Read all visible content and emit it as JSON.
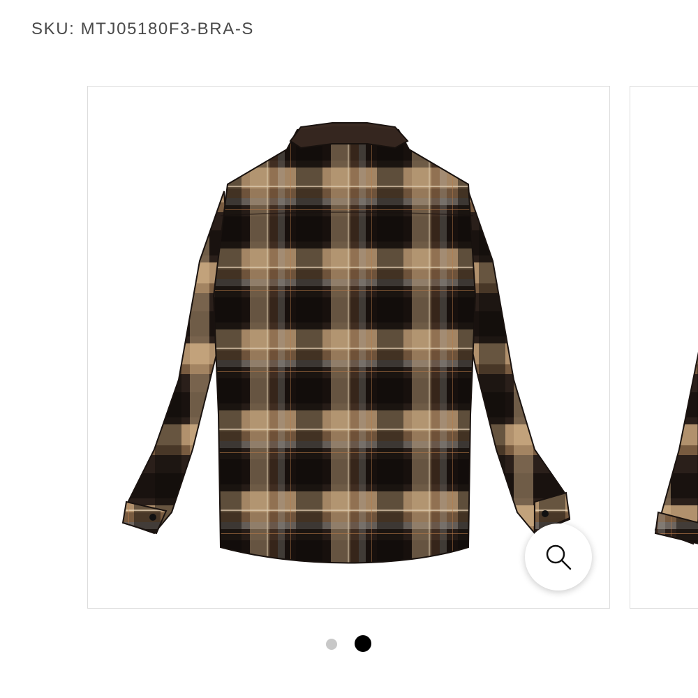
{
  "product": {
    "sku_text": "SKU: MTJ05180F3-BRA-S"
  },
  "gallery": {
    "slides": [
      {
        "image_alt": "Brown plaid flannel shirt jacket, back view"
      },
      {
        "image_alt": "Brown plaid flannel shirt jacket, partial view"
      }
    ],
    "zoom_icon": "magnifier-icon",
    "pagination": {
      "total": 2,
      "active": 2
    }
  },
  "colors": {
    "plaid_dark": "#1c1614",
    "plaid_brown": "#5e3a22",
    "plaid_tan": "#d6b48a",
    "plaid_grey": "#8a8580",
    "dot_inactive": "#c8c8c8",
    "dot_active": "#000000"
  }
}
